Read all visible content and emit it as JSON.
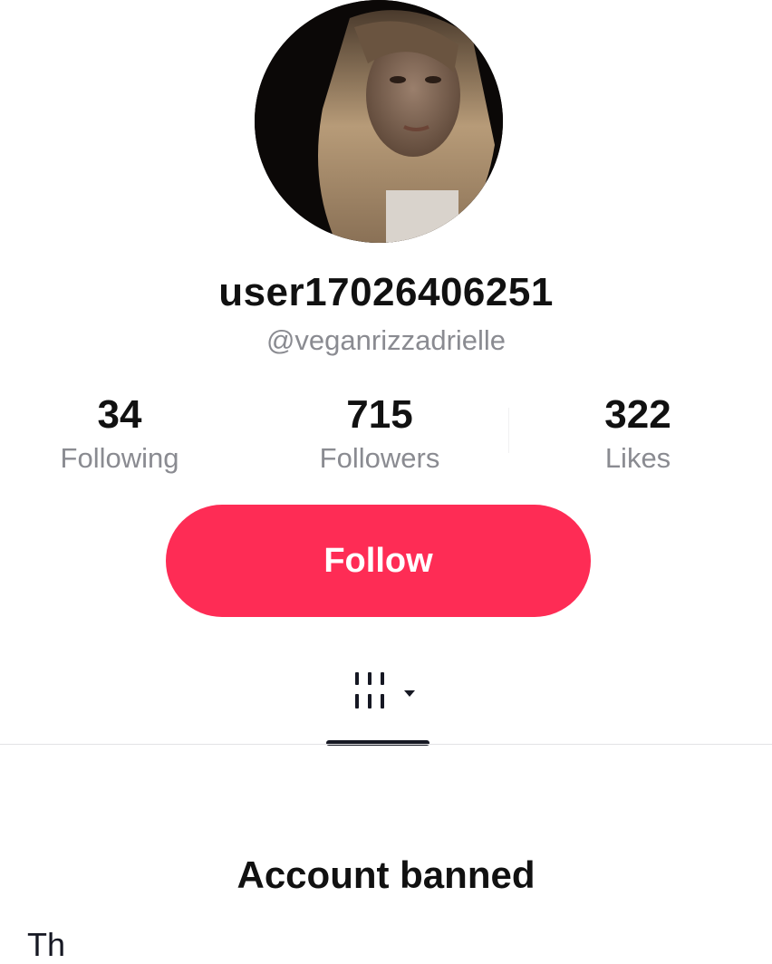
{
  "profile": {
    "username": "user17026406251",
    "handle": "@veganrizzadrielle"
  },
  "stats": [
    {
      "value": "34",
      "label": "Following"
    },
    {
      "value": "715",
      "label": "Followers"
    },
    {
      "value": "322",
      "label": "Likes"
    }
  ],
  "actions": {
    "follow_label": "Follow"
  },
  "tabs": {
    "active_icon": "grid-icon",
    "dropdown_icon": "caret-down-icon"
  },
  "ban_notice": {
    "title": "Account banned",
    "body": "Th"
  },
  "colors": {
    "accent": "#fe2c55",
    "text_primary": "#111111",
    "text_secondary": "#8a8b91"
  }
}
